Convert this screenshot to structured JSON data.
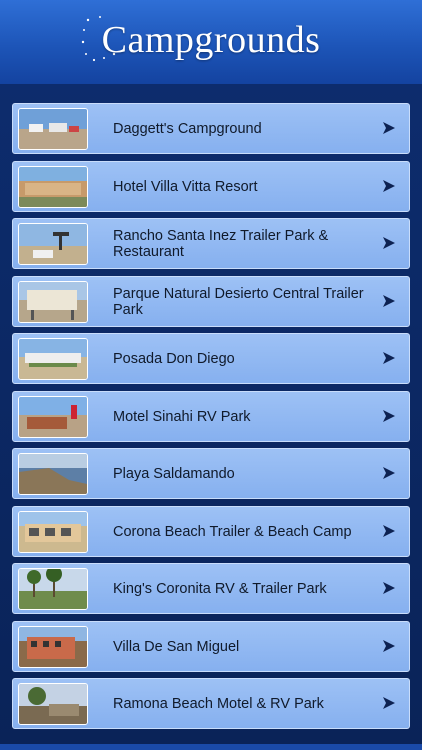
{
  "header": {
    "title": "Campgrounds"
  },
  "items": [
    {
      "label": "Daggett's Campground",
      "thumb": "campground-photo"
    },
    {
      "label": "Hotel Villa Vitta Resort",
      "thumb": "resort-photo"
    },
    {
      "label": "Rancho Santa Inez Trailer Park & Restaurant",
      "thumb": "desert-sign-photo"
    },
    {
      "label": "Parque Natural Desierto Central Trailer Park",
      "thumb": "park-sign-photo"
    },
    {
      "label": "Posada Don Diego",
      "thumb": "posada-photo"
    },
    {
      "label": "Motel Sinahi RV Park",
      "thumb": "motel-photo"
    },
    {
      "label": "Playa Saldamando",
      "thumb": "beach-cliff-photo"
    },
    {
      "label": "Corona Beach Trailer & Beach Camp",
      "thumb": "beach-building-photo"
    },
    {
      "label": "King's Coronita RV & Trailer Park",
      "thumb": "palm-trees-photo"
    },
    {
      "label": "Villa De San Miguel",
      "thumb": "villa-photo"
    },
    {
      "label": "Ramona Beach Motel & RV Park",
      "thumb": "motel-sign-photo"
    }
  ]
}
